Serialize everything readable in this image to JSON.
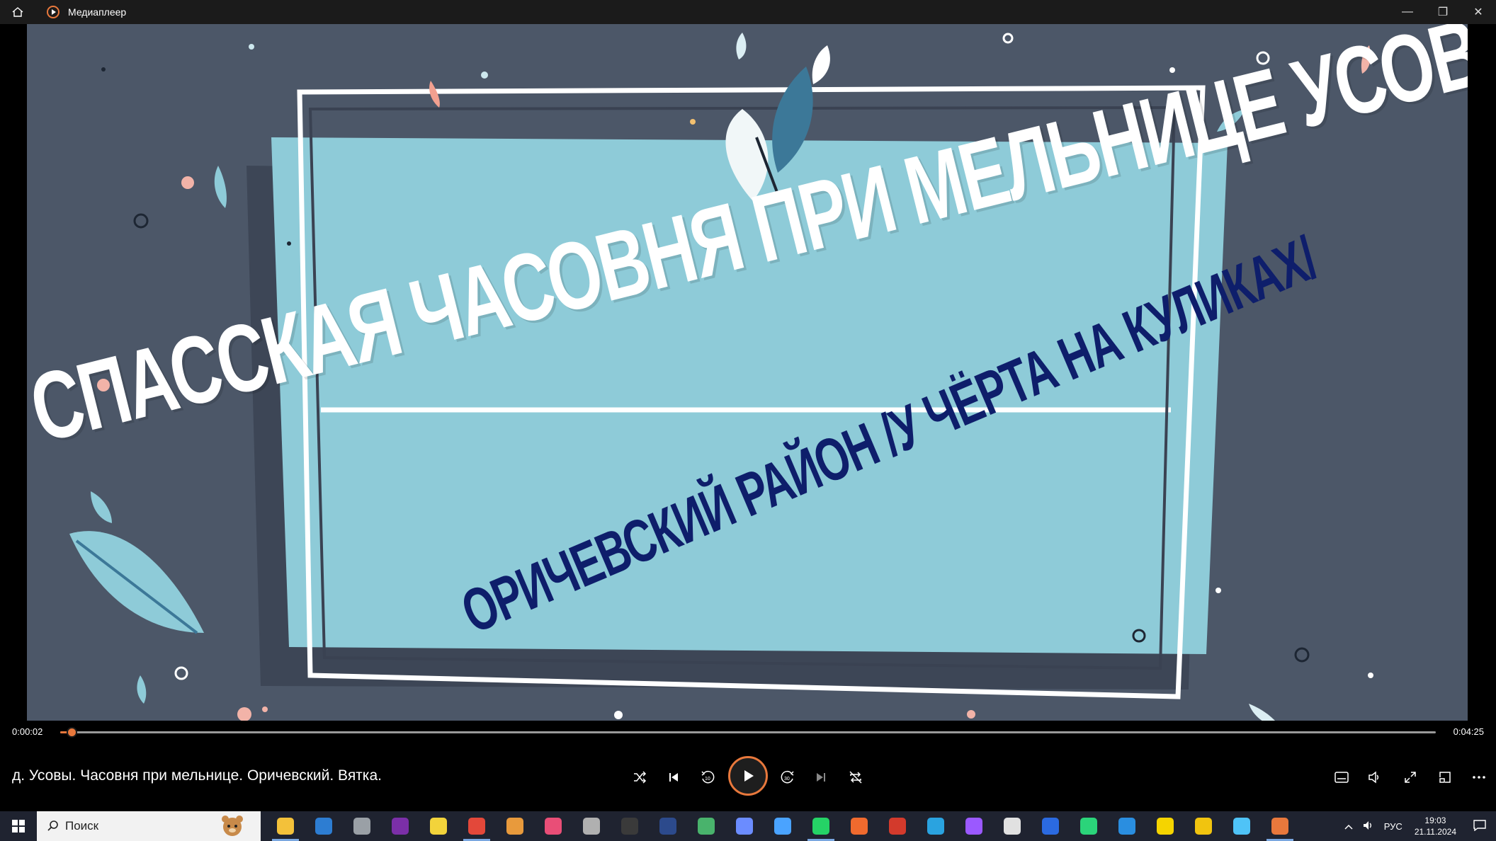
{
  "titlebar": {
    "title": "Медиаплеер",
    "minimize": "—",
    "restore": "❐",
    "close": "✕"
  },
  "video": {
    "headline": "СПАССКАЯ ЧАСОВНЯ ПРИ МЕЛЬНИЦЕ УСОВА",
    "subline": "ОРИЧЕВСКИЙ РАЙОН /У ЧЁРТА НА КУЛИКАХ/"
  },
  "playback": {
    "current_time": "0:00:02",
    "total_time": "0:04:25",
    "progress_fraction": 0.008
  },
  "controls": {
    "media_title": "д. Усовы. Часовня при мельнице. Оричевский. Вятка."
  },
  "taskbar": {
    "search_placeholder": "Поиск",
    "language": "РУС",
    "time": "19:03",
    "date": "21.11.2024",
    "apps": [
      {
        "name": "file-explorer",
        "color": "#f3c13a",
        "active": true
      },
      {
        "name": "store",
        "color": "#2d7dd2",
        "active": false
      },
      {
        "name": "settings",
        "color": "#9aa0a6",
        "active": false
      },
      {
        "name": "onenote",
        "color": "#7b2fa8",
        "active": false
      },
      {
        "name": "sticky-notes",
        "color": "#f2d33b",
        "active": false
      },
      {
        "name": "chrome",
        "color": "#e3483a",
        "active": true
      },
      {
        "name": "package",
        "color": "#e89a3c",
        "active": false
      },
      {
        "name": "camera",
        "color": "#e94e77",
        "active": false
      },
      {
        "name": "crow-app",
        "color": "#b0b0b0",
        "active": false
      },
      {
        "name": "obs",
        "color": "#3a3a3a",
        "active": false
      },
      {
        "name": "media-app",
        "color": "#2c4a8c",
        "active": false
      },
      {
        "name": "maps",
        "color": "#49b36c",
        "active": false
      },
      {
        "name": "tool-app",
        "color": "#6b8cff",
        "active": false
      },
      {
        "name": "snip",
        "color": "#4aa3ff",
        "active": false
      },
      {
        "name": "whatsapp",
        "color": "#25d366",
        "active": true
      },
      {
        "name": "app-orange",
        "color": "#f06a2e",
        "active": false
      },
      {
        "name": "pinterest",
        "color": "#d33a2c",
        "active": false
      },
      {
        "name": "telegram",
        "color": "#2aa3e0",
        "active": false
      },
      {
        "name": "circle-app",
        "color": "#9b59ff",
        "active": false
      },
      {
        "name": "davinci",
        "color": "#e1e1e1",
        "active": false
      },
      {
        "name": "app-blue",
        "color": "#2b6ae0",
        "active": false
      },
      {
        "name": "app-green",
        "color": "#2bd47a",
        "active": false
      },
      {
        "name": "app-blue2",
        "color": "#2a8ee0",
        "active": false
      },
      {
        "name": "app-yellow",
        "color": "#f5d400",
        "active": false
      },
      {
        "name": "app-yellow2",
        "color": "#f1c40f",
        "active": false
      },
      {
        "name": "app-cyan",
        "color": "#4fc3f7",
        "active": false
      },
      {
        "name": "media-player",
        "color": "#e8783c",
        "active": true
      }
    ]
  }
}
